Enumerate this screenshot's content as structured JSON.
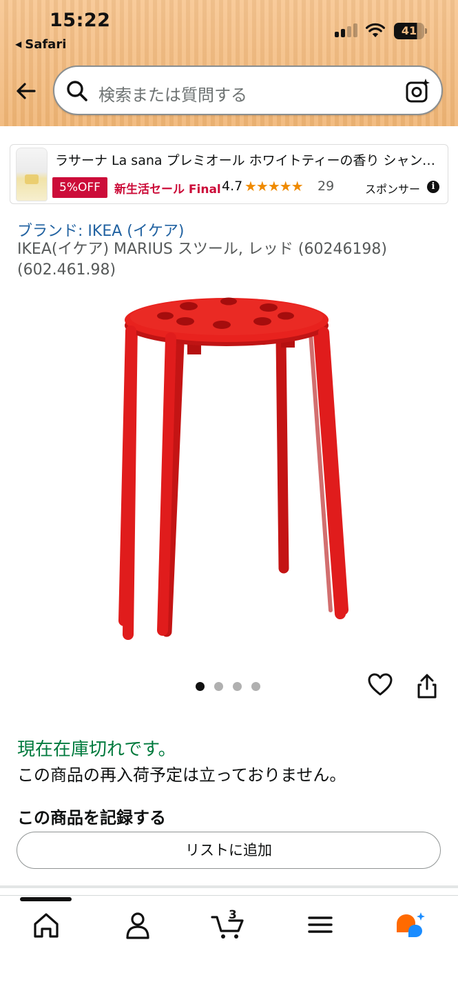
{
  "status_bar": {
    "time": "15:22",
    "back_app": "Safari",
    "battery": "41"
  },
  "header": {
    "search_placeholder": "検索または質問する"
  },
  "ad": {
    "title": "ラサーナ La sana プレミオール ホワイトティーの香り シャンプー",
    "badge": "5%OFF",
    "sale": "新生活セール Final",
    "rating": "4.7",
    "stars_value": 4.7,
    "stars": "★★★★★",
    "review_count": "29",
    "sponsored": "スポンサー",
    "info": "i"
  },
  "product": {
    "brand": "ブランド: IKEA (イケア)",
    "title": "IKEA(イケア) MARIUS スツール, レッド (60246198) (602.461.98)",
    "image_index": 1,
    "image_count": 4,
    "stock_status": "現在在庫切れです。",
    "restock_note": "この商品の再入荷予定は立っておりません。",
    "record_heading": "この商品を記録する",
    "add_to_list": "リストに追加"
  },
  "nav": {
    "cart_count": "3",
    "items": [
      "home-icon",
      "account-icon",
      "cart-icon",
      "menu-icon",
      "rufus-icon"
    ]
  },
  "colors": {
    "header_bg": "#f3bd84",
    "brand_link": "#2162a1",
    "in_stock_green": "#007a3d",
    "deal_red": "#cc0c39",
    "star_orange": "#ef8a00",
    "stool_red": "#e01c1c"
  }
}
